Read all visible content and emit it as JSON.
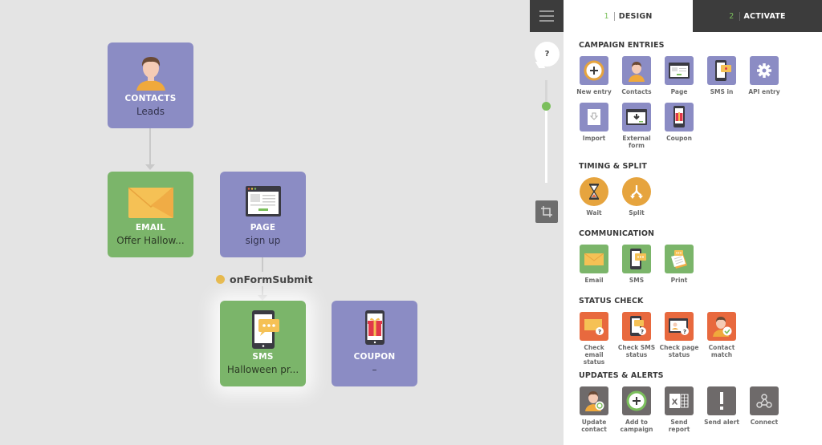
{
  "canvas": {
    "nodes": [
      {
        "id": "contacts",
        "title": "CONTACTS",
        "subtitle": "Leads",
        "color": "purple",
        "icon": "person-icon"
      },
      {
        "id": "email",
        "title": "EMAIL",
        "subtitle": "Offer Hallow...",
        "color": "green",
        "icon": "envelope-icon"
      },
      {
        "id": "page",
        "title": "PAGE",
        "subtitle": "sign up",
        "color": "purple",
        "icon": "webpage-icon"
      },
      {
        "id": "sms",
        "title": "SMS",
        "subtitle": "Halloween pr...",
        "color": "green",
        "icon": "phone-chat-icon",
        "selected": true
      },
      {
        "id": "coupon",
        "title": "COUPON",
        "subtitle": "–",
        "color": "purple",
        "icon": "phone-gift-icon"
      }
    ],
    "event_label": "onFormSubmit",
    "event_color": "#e6b84a"
  },
  "controls": {
    "help_label": "?",
    "zoom_level": 0.75
  },
  "tabs": [
    {
      "num": "1",
      "label": "DESIGN",
      "active": true
    },
    {
      "num": "2",
      "label": "ACTIVATE",
      "active": false
    }
  ],
  "sections": {
    "campaign_entries": {
      "title": "CAMPAIGN ENTRIES",
      "items": [
        {
          "label": "New entry",
          "icon": "plus-circle-icon"
        },
        {
          "label": "Contacts",
          "icon": "person-icon"
        },
        {
          "label": "Page",
          "icon": "webpage-icon"
        },
        {
          "label": "SMS in",
          "icon": "phone-message-icon"
        },
        {
          "label": "API entry",
          "icon": "gear-icon"
        },
        {
          "label": "Import",
          "icon": "file-import-icon"
        },
        {
          "label": "External form",
          "icon": "download-window-icon"
        },
        {
          "label": "Coupon",
          "icon": "phone-gift-icon"
        }
      ]
    },
    "timing_split": {
      "title": "TIMING & SPLIT",
      "items": [
        {
          "label": "Wait",
          "icon": "hourglass-icon"
        },
        {
          "label": "Split",
          "icon": "split-arrows-icon"
        }
      ]
    },
    "communication": {
      "title": "COMMUNICATION",
      "items": [
        {
          "label": "Email",
          "icon": "envelope-icon"
        },
        {
          "label": "SMS",
          "icon": "phone-chat-icon"
        },
        {
          "label": "Print",
          "icon": "print-icon"
        }
      ]
    },
    "status_check": {
      "title": "STATUS CHECK",
      "items": [
        {
          "label": "Check email status",
          "icon": "envelope-question-icon"
        },
        {
          "label": "Check SMS status",
          "icon": "phone-question-icon"
        },
        {
          "label": "Check page status",
          "icon": "page-question-icon"
        },
        {
          "label": "Contact match",
          "icon": "person-check-icon"
        }
      ]
    },
    "updates_alerts": {
      "title": "UPDATES & ALERTS",
      "items": [
        {
          "label": "Update contact",
          "icon": "person-refresh-icon"
        },
        {
          "label": "Add to campaign",
          "icon": "plus-circle-icon"
        },
        {
          "label": "Send report",
          "icon": "excel-icon"
        },
        {
          "label": "Send alert",
          "icon": "exclamation-icon"
        },
        {
          "label": "Connect",
          "icon": "webhook-icon"
        }
      ]
    }
  }
}
